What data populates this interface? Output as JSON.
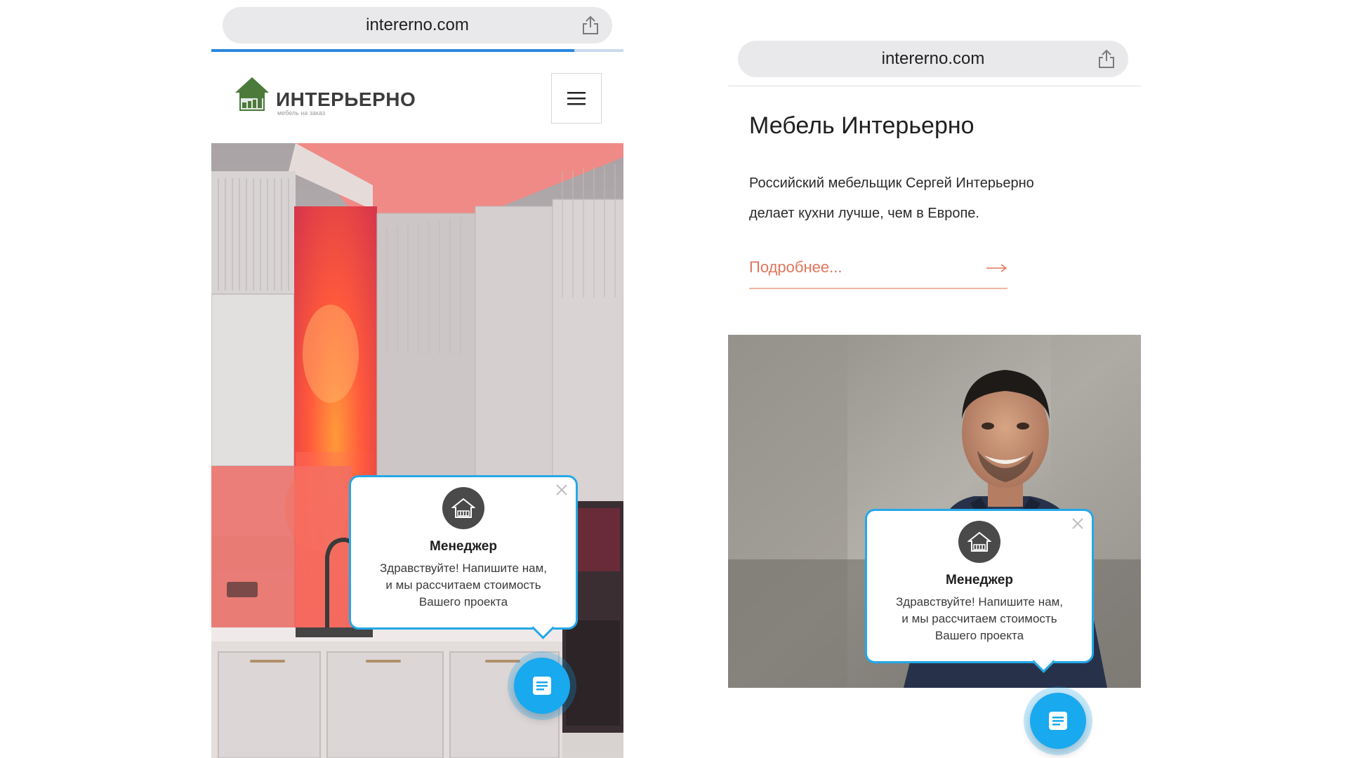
{
  "left": {
    "url": "intererno.com",
    "load_progress": 0.88,
    "logo": {
      "title": "ИНТЕРЬЕРНО",
      "subtitle": "мебель на заказ"
    },
    "chat_popup": {
      "name": "Менеджер",
      "message_lines": [
        "Здравствуйте! Напишите нам,",
        "и мы рассчитаем стоимость",
        "Вашего проекта"
      ]
    }
  },
  "right": {
    "url": "intererno.com",
    "title": "Мебель Интерьерно",
    "text_lines": [
      "Российский мебельщик Сергей Интерьерно",
      "делает кухни лучше, чем в Европе."
    ],
    "more_link": "Подробнее...",
    "chat_popup": {
      "name": "Менеджер",
      "message_lines": [
        "Здравствуйте! Напишите нам,",
        "и мы рассчитаем стоимость",
        "Вашего проекта"
      ]
    }
  },
  "colors": {
    "accent_blue": "#19a9ee",
    "link_orange": "#e0765c",
    "logo_green": "#4c7a3a"
  },
  "icons": [
    "share-icon",
    "hamburger-menu-icon",
    "close-icon",
    "house-logo-icon",
    "chat-icon",
    "arrow-right-icon"
  ]
}
